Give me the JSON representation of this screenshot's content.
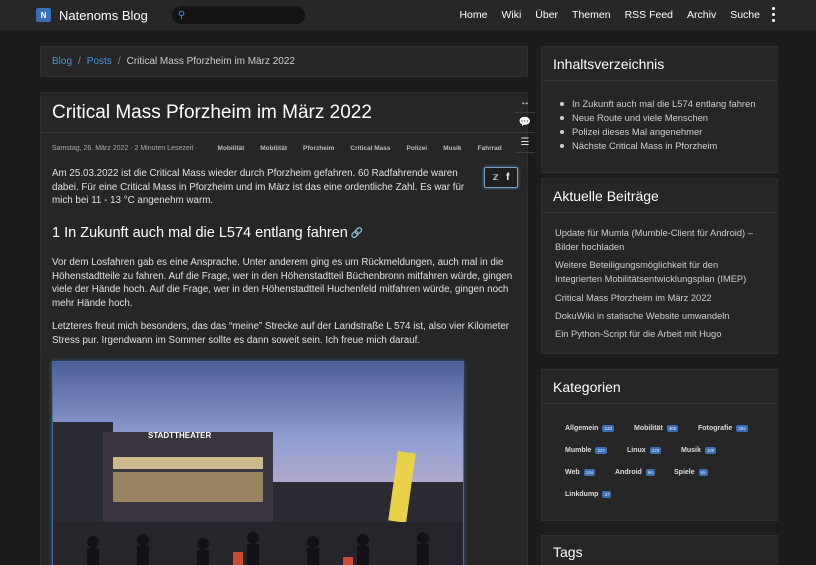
{
  "nav": {
    "brand": "Natenoms Blog",
    "links": [
      "Home",
      "Wiki",
      "Über",
      "Themen",
      "RSS Feed",
      "Archiv",
      "Suche"
    ]
  },
  "breadcrumb": {
    "items": [
      "Blog",
      "Posts"
    ],
    "current": "Critical Mass Pforzheim im März 2022"
  },
  "post": {
    "title": "Critical Mass Pforzheim im März 2022",
    "date": "Samstag, 26. März 2022",
    "reading_time": "2 Minuten Lesezeit",
    "tags": [
      "Mobilität",
      "Mobilität",
      "Pforzheim",
      "Critical Mass",
      "Polizei",
      "Musik",
      "Fahrrad"
    ],
    "intro": "Am 25.03.2022 ist die Critical Mass wieder durch Pforzheim gefahren. 60 Radfahrende waren dabei. Für eine Critical Mass in Pforzheim und im März ist das eine ordentliche Zahl. Es war für mich bei 11 - 13 °C angenehm warm.",
    "section1_heading": "1 In Zukunft auch mal die L574 entlang fahren",
    "section1_para1": "Vor dem Losfahren gab es eine Ansprache. Unter anderem ging es um Rückmeldungen, auch mal in die Höhenstadtteile zu fahren. Auf die Frage, wer in den Höhenstadtteil Büchenbronn mitfahren würde, gingen viele der Hände hoch. Auf die Frage, wer in den Höhenstadtteil Huchenfeld mitfahren würde, gingen noch mehr Hände hoch.",
    "section1_para2": "Letzteres freut mich besonders, das das “meine” Strecke auf der Landstraße L 574 ist, also vier Kilometer Stress pur. Irgendwann im Sommer sollte es dann soweit sein. Ich freue mich darauf.",
    "photo_sign": "STADTTHEATER"
  },
  "sidebar": {
    "toc_title": "Inhaltsverzeichnis",
    "toc": [
      "In Zukunft auch mal die L574 entlang fahren",
      "Neue Route und viele Menschen",
      "Polizei dieses Mal angenehmer",
      "Nächste Critical Mass in Pforzheim"
    ],
    "recent_title": "Aktuelle Beiträge",
    "recent": [
      "Update für Mumla (Mumble-Client für Android) – Bilder hochladen",
      "Weitere Beteiligungsmöglichkeit für den Integrierten Mobilitätsentwicklungsplan (IMEP)",
      "Critical Mass Pforzheim im März 2022",
      "DokuWiki in statische Website umwandeln",
      "Ein Python-Script für die Arbeit mit Hugo"
    ],
    "categories_title": "Kategorien",
    "categories": [
      {
        "name": "Allgemein",
        "count": "633"
      },
      {
        "name": "Mobilität",
        "count": "405"
      },
      {
        "name": "Fotografie",
        "count": "392"
      },
      {
        "name": "Mumble",
        "count": "227"
      },
      {
        "name": "Linux",
        "count": "228"
      },
      {
        "name": "Musik",
        "count": "108"
      },
      {
        "name": "Web",
        "count": "104"
      },
      {
        "name": "Android",
        "count": "96"
      },
      {
        "name": "Spiele",
        "count": "65"
      },
      {
        "name": "Linkdump",
        "count": "37"
      }
    ],
    "tags_title": "Tags"
  },
  "colors": {
    "accent": "#3b6fb5",
    "link": "#4e93e3",
    "background": "#1c1c1c",
    "card": "#262626"
  }
}
